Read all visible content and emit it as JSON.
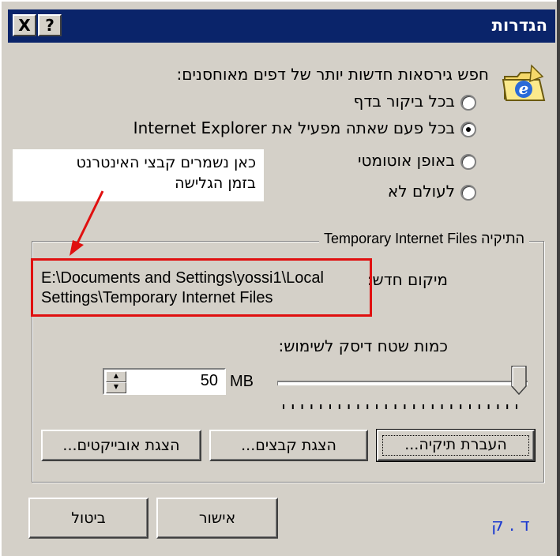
{
  "titlebar": {
    "title": "הגדרות",
    "close_label": "X",
    "help_label": "?"
  },
  "check": {
    "heading": "חפש גירסאות חדשות יותר של דפים מאוחסנים:",
    "options": [
      {
        "label": "בכל ביקור בדף",
        "selected": false
      },
      {
        "label": "בכל פעם שאתה מפעיל את Internet Explorer",
        "selected": true
      },
      {
        "label": "באופן אוטומטי",
        "selected": false
      },
      {
        "label": "לעולם לא",
        "selected": false
      }
    ]
  },
  "annotation": {
    "note_line1": "כאן נשמרים קבצי האינטרנט",
    "note_line2": "בזמן הגלישה",
    "arrow_color": "#e01010",
    "box_color": "#e01010"
  },
  "temp_files": {
    "group_title": "התיקיה Temporary Internet Files",
    "location_label": "מיקום חדש:",
    "path_line1": "E:\\Documents and Settings\\yossi1\\Local",
    "path_line2": "Settings\\Temporary Internet Files",
    "disk_label": "כמות שטח דיסק לשימוש:",
    "disk_value": "50",
    "disk_unit": "MB",
    "slider_level": 1.0
  },
  "buttons": {
    "move_folder": "העברת תיקיה...",
    "view_files": "הצגת קבצים...",
    "view_objects": "הצגת אובייקטים...",
    "ok": "אישור",
    "cancel": "ביטול"
  },
  "signature": "ד . ק",
  "colors": {
    "titlebar": "#0a246a",
    "dialog_bg": "#d4d0c8",
    "highlight": "#e01010",
    "signature": "#1e3cd0"
  },
  "icons": {
    "app_icon": "ie-folder-icon"
  }
}
